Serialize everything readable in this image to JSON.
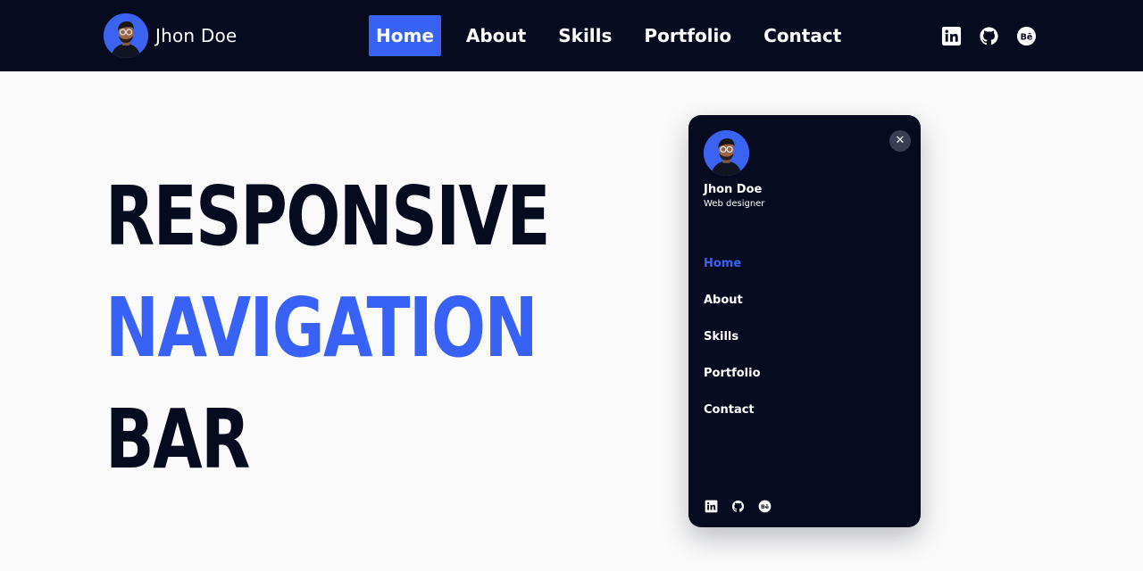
{
  "brand": {
    "name": "Jhon Doe",
    "avatar_icon": "profile-photo"
  },
  "nav": {
    "items": [
      {
        "label": "Home",
        "active": true
      },
      {
        "label": "About",
        "active": false
      },
      {
        "label": "Skills",
        "active": false
      },
      {
        "label": "Portfolio",
        "active": false
      },
      {
        "label": "Contact",
        "active": false
      }
    ]
  },
  "socials": [
    {
      "icon": "linkedin-icon"
    },
    {
      "icon": "github-icon"
    },
    {
      "icon": "behance-icon"
    }
  ],
  "hero": {
    "line1": "RESPONSIVE",
    "line2": "NAVIGATION",
    "line3": "BAR"
  },
  "drawer": {
    "name": "Jhon Doe",
    "role": "Web designer",
    "close_icon": "close-icon",
    "items": [
      {
        "label": "Home",
        "active": true
      },
      {
        "label": "About",
        "active": false
      },
      {
        "label": "Skills",
        "active": false
      },
      {
        "label": "Portfolio",
        "active": false
      },
      {
        "label": "Contact",
        "active": false
      }
    ]
  },
  "colors": {
    "navy": "#070b1f",
    "accent": "#3862f5",
    "background": "#fafafa",
    "text_light": "#ffffff"
  }
}
